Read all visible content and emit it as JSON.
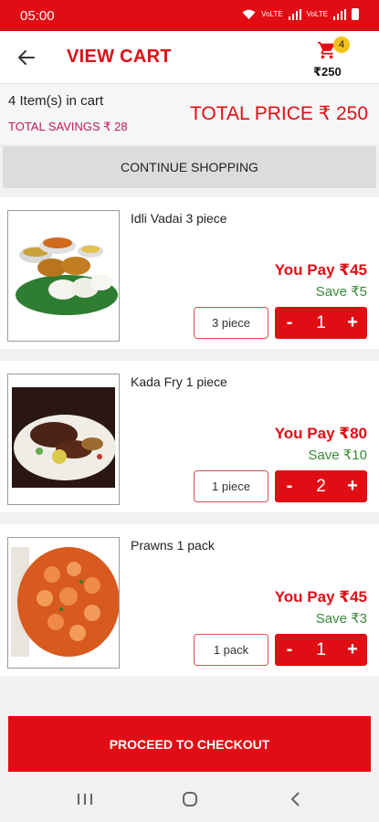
{
  "status_bar": {
    "time": "05:00",
    "net1": "VoLTE",
    "net2": "VoLTE"
  },
  "header": {
    "title": "VIEW CART",
    "cart_count": "4",
    "cart_total": "₹250"
  },
  "summary": {
    "item_count": "4 Item(s) in cart",
    "savings": "TOTAL SAVINGS ₹ 28",
    "total_price": "TOTAL PRICE ₹ 250"
  },
  "continue_label": "CONTINUE SHOPPING",
  "items": [
    {
      "name": "Idli Vadai 3 piece",
      "you_pay": "You Pay ₹45",
      "save": "Save ₹5",
      "unit": "3 piece",
      "qty": "1",
      "minus": "-",
      "plus": "+"
    },
    {
      "name": "Kada Fry 1 piece",
      "you_pay": "You Pay ₹80",
      "save": "Save ₹10",
      "unit": "1 piece",
      "qty": "2",
      "minus": "-",
      "plus": "+"
    },
    {
      "name": "Prawns 1 pack",
      "you_pay": "You Pay ₹45",
      "save": "Save ₹3",
      "unit": "1 pack",
      "qty": "1",
      "minus": "-",
      "plus": "+"
    }
  ],
  "checkout_label": "PROCEED TO CHECKOUT",
  "colors": {
    "brand_red": "#e10d14",
    "badge_yellow": "#f4c21a",
    "save_green": "#3a8a3a",
    "savings_pink": "#c2185b"
  },
  "icons": [
    "back-arrow-icon",
    "cart-icon",
    "recent-apps-icon",
    "home-icon",
    "nav-back-icon"
  ]
}
